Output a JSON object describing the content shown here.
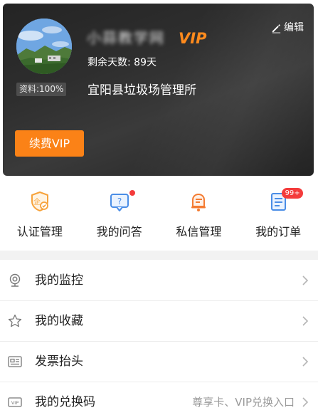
{
  "profile": {
    "username": "小蒜教学网",
    "vip_label": "VIP",
    "edit_label": "编辑",
    "days_left": "剩余天数: 89天",
    "org_name": "宜阳县垃圾场管理所",
    "completeness": "资料:100%",
    "renew_label": "续费VIP"
  },
  "quick_menu": [
    {
      "label": "认证管理",
      "icon": "shield-certificate-icon"
    },
    {
      "label": "我的问答",
      "icon": "question-bubble-icon",
      "dot": true
    },
    {
      "label": "私信管理",
      "icon": "bell-message-icon"
    },
    {
      "label": "我的订单",
      "icon": "order-list-icon",
      "badge": "99+"
    }
  ],
  "menu_list": [
    {
      "label": "我的监控",
      "icon": "webcam-icon"
    },
    {
      "label": "我的收藏",
      "icon": "star-icon"
    },
    {
      "label": "发票抬头",
      "icon": "invoice-card-icon"
    },
    {
      "label": "我的兑换码",
      "icon": "vip-ticket-icon",
      "hint": "尊享卡、VIP兑换入口"
    }
  ],
  "colors": {
    "accent": "#fb8217",
    "badge_red": "#f43b3b",
    "card_dark": "#2e2e2e"
  }
}
